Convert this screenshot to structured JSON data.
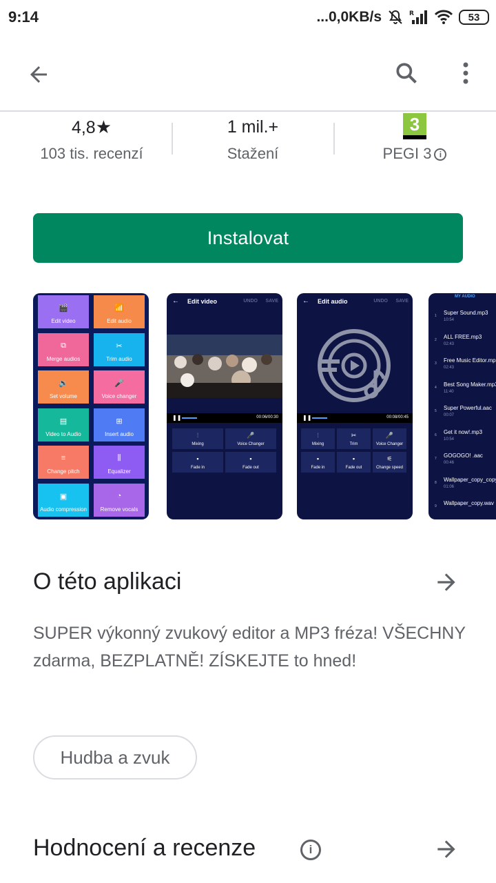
{
  "status_bar": {
    "time": "9:14",
    "network_speed": "...0,0KB/s",
    "battery": "53",
    "icons": [
      "mute-icon",
      "signal-icon",
      "wifi-icon",
      "battery-icon"
    ]
  },
  "app_bar": {
    "icons": [
      "back-arrow-icon",
      "search-icon",
      "more-vert-icon"
    ]
  },
  "stats": {
    "rating_value": "4,8",
    "rating_star": "★",
    "reviews_label": "103 tis. recenzí",
    "downloads_value": "1 mil.+",
    "downloads_label": "Stažení",
    "pegi_badge": "3",
    "pegi_label": "PEGI 3",
    "pegi_info": "i"
  },
  "install": {
    "label": "Instalovat",
    "color": "#01875f"
  },
  "screenshots": {
    "shot1_tiles": [
      {
        "label": "Edit video",
        "icon": "🎬",
        "color": "#9b6ff2"
      },
      {
        "label": "Edit audio",
        "icon": "📶",
        "color": "#f58a4a"
      },
      {
        "label": "Merge audios",
        "icon": "⧉",
        "color": "#f0689a"
      },
      {
        "label": "Trim audio",
        "icon": "✂",
        "color": "#16b3ee"
      },
      {
        "label": "Set volume",
        "icon": "🔉",
        "color": "#f78b4e"
      },
      {
        "label": "Voice changer",
        "icon": "🎤",
        "color": "#f56da0"
      },
      {
        "label": "Video to Audio",
        "icon": "▤",
        "color": "#15b89a"
      },
      {
        "label": "Insert audio",
        "icon": "⊞",
        "color": "#4f7cf5"
      },
      {
        "label": "Change pitch",
        "icon": "≡",
        "color": "#f77a66"
      },
      {
        "label": "Equalizer",
        "icon": "⫼",
        "color": "#8e5cf2"
      },
      {
        "label": "Audio compression",
        "icon": "▣",
        "color": "#17c1f0"
      },
      {
        "label": "Remove vocals",
        "icon": "◔",
        "color": "#a867e8"
      }
    ],
    "shot2": {
      "back": "←",
      "title": "Edit video",
      "undo": "UNDO",
      "save": "SAVE",
      "play": "❚❚",
      "time": "00:06/00:30",
      "controls": [
        {
          "label": "Mixing",
          "icon": "⫶"
        },
        {
          "label": "Voice Changer",
          "icon": "🎤"
        },
        {
          "label": "Fade in",
          "icon": "▪"
        },
        {
          "label": "Fade out",
          "icon": "▪"
        }
      ]
    },
    "shot3": {
      "back": "←",
      "title": "Edit audio",
      "undo": "UNDO",
      "save": "SAVE",
      "play": "❚❚",
      "time": "00:08/00:45",
      "controls": [
        {
          "label": "Mixing",
          "icon": "⫶"
        },
        {
          "label": "Trim",
          "icon": "✂"
        },
        {
          "label": "Voice Changer",
          "icon": "🎤"
        },
        {
          "label": "Fade in",
          "icon": "▪"
        },
        {
          "label": "Fade out",
          "icon": "▪"
        },
        {
          "label": "Change speed",
          "icon": "⚟"
        }
      ]
    },
    "shot4": {
      "header": "MY AUDIO",
      "items": [
        {
          "num": "1",
          "name": "Super Sound.mp3",
          "time": "10:54"
        },
        {
          "num": "2",
          "name": "ALL FREE.mp3",
          "time": "02:43"
        },
        {
          "num": "3",
          "name": "Free Music Editor.mp3",
          "time": "02:43"
        },
        {
          "num": "4",
          "name": "Best Song Maker.mp3",
          "time": "11:40"
        },
        {
          "num": "5",
          "name": "Super Powerful.aac",
          "time": "00:07"
        },
        {
          "num": "6",
          "name": "Get it now!.mp3",
          "time": "10:54"
        },
        {
          "num": "7",
          "name": "GOGOGO! .aac",
          "time": "00:46"
        },
        {
          "num": "8",
          "name": "Wallpaper_copy_copy.wav",
          "time": "01:06"
        },
        {
          "num": "9",
          "name": "Wallpaper_copy.wav",
          "time": ""
        }
      ]
    }
  },
  "about": {
    "title": "O této aplikaci",
    "description": "SUPER výkonný zvukový editor a MP3 fréza! VŠECHNY zdarma, BEZPLATNĚ! ZÍSKEJTE to hned!",
    "category_chip": "Hudba a zvuk"
  },
  "reviews": {
    "title": "Hodnocení a recenze",
    "info": "i"
  }
}
